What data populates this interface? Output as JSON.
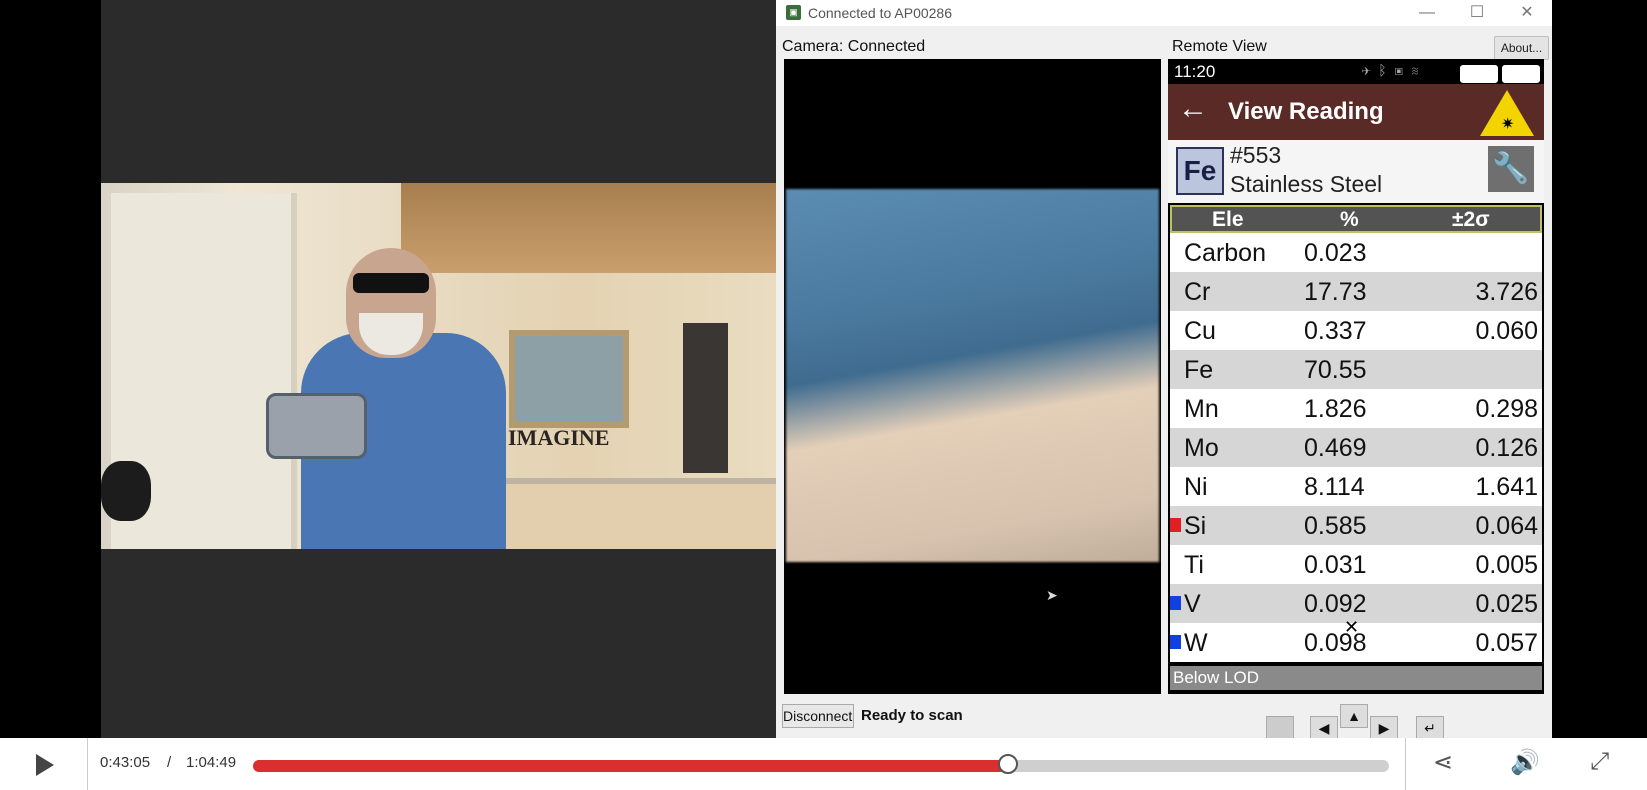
{
  "app_window": {
    "title": "Connected to AP00286",
    "title_icon": "app-icon",
    "camera_label": "Camera: Connected",
    "remote_label": "Remote View",
    "about_button": "About...",
    "disconnect_button": "Disconnect",
    "status": "Ready to scan",
    "window_controls": [
      "—",
      "☐",
      "✕"
    ]
  },
  "webcam": {
    "sign_text": "IMAGINE"
  },
  "phone": {
    "time": "11:20",
    "header_title": "View Reading",
    "back_arrow": "←",
    "element_badge": "Fe",
    "reading_number": "#553",
    "reading_type": "Stainless Steel",
    "table_headers": [
      "Ele",
      "%",
      "±2σ"
    ],
    "rows": [
      {
        "element": "Carbon",
        "percent": "0.023",
        "sigma": "",
        "marker": ""
      },
      {
        "element": "Cr",
        "percent": "17.73",
        "sigma": "3.726",
        "marker": ""
      },
      {
        "element": "Cu",
        "percent": "0.337",
        "sigma": "0.060",
        "marker": ""
      },
      {
        "element": "Fe",
        "percent": "70.55",
        "sigma": "",
        "marker": ""
      },
      {
        "element": "Mn",
        "percent": "1.826",
        "sigma": "0.298",
        "marker": ""
      },
      {
        "element": "Mo",
        "percent": "0.469",
        "sigma": "0.126",
        "marker": ""
      },
      {
        "element": "Ni",
        "percent": "8.114",
        "sigma": "1.641",
        "marker": ""
      },
      {
        "element": "Si",
        "percent": "0.585",
        "sigma": "0.064",
        "marker": "#e02020"
      },
      {
        "element": "Ti",
        "percent": "0.031",
        "sigma": "0.005",
        "marker": ""
      },
      {
        "element": "V",
        "percent": "0.092",
        "sigma": "0.025",
        "marker": "#1040e0"
      },
      {
        "element": "W",
        "percent": "0.098",
        "sigma": "0.057",
        "marker": "#1040e0"
      }
    ],
    "footer": "Below LOD"
  },
  "player": {
    "current_time": "0:43:05",
    "separator": "/",
    "total_time": "1:04:49",
    "progress_fraction": 0.665,
    "accent_color": "#d92f2f"
  }
}
